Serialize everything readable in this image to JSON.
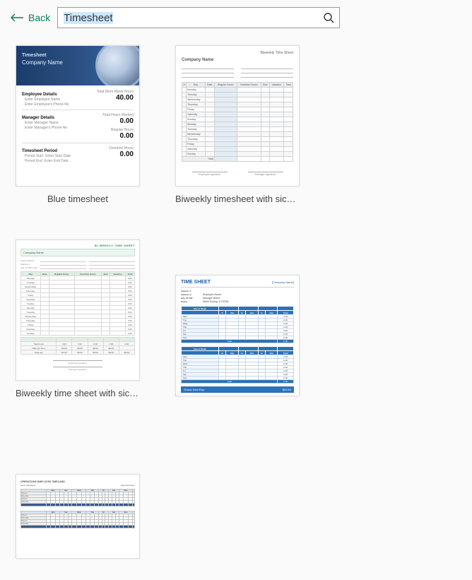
{
  "nav": {
    "back_label": "Back"
  },
  "search": {
    "value": "Timesheet"
  },
  "results": [
    {
      "label": "Blue timesheet"
    },
    {
      "label": "Biweekly timesheet with sick l…"
    },
    {
      "label": "Biweekly time sheet with sick…"
    },
    {
      "label": ""
    },
    {
      "label": ""
    }
  ],
  "thumb1": {
    "title": "Timesheet",
    "company": "Company Name",
    "emp_hdr": "Employee Details",
    "emp_name": "Enter Employee Name",
    "emp_phone": "Enter Employee's Phone No",
    "mgr_hdr": "Manager Details",
    "mgr_name": "Enter Manager Name",
    "mgr_phone": "Enter Manager's Phone No",
    "period_hdr": "Timesheet Period",
    "period_start_lbl": "Period Start",
    "period_start_val": "Enter Start Date",
    "period_end_lbl": "Period End",
    "period_end_val": "Enter End Date",
    "total_week_lbl": "Total Work Week Hours",
    "total_week_val": "40.00",
    "total_worked_lbl": "Total Hours Worked",
    "total_worked_val": "0.00",
    "regular_lbl": "Regular Hours",
    "regular_val": "0.00",
    "overtime_lbl": "Overtime Hours",
    "overtime_val": "0.00"
  },
  "thumb2": {
    "title": "Biweekly Time Sheet",
    "company": "Company Name",
    "cols": [
      "#",
      "Day",
      "Date",
      "Regular Hours",
      "Overtime Hours",
      "Sick",
      "Vacation",
      "Total"
    ],
    "days": [
      "Monday",
      "Tuesday",
      "Wednesday",
      "Thursday",
      "Friday",
      "Saturday",
      "Sunday",
      "Monday",
      "Tuesday",
      "Wednesday",
      "Thursday",
      "Friday",
      "Saturday",
      "Sunday"
    ],
    "total_lbl": "Total",
    "sig_emp": "Employee signature",
    "sig_mgr": "Manager signature"
  },
  "thumb3": {
    "title": "BI-WEEKLY TIME SHEET",
    "company_lbl": "Company Name",
    "addr": "Street Address",
    "addr2": "Address 2",
    "city": "City, ST ZIP Code",
    "mgr": "Manager",
    "emp": "Employee",
    "emp_phone": "Employee phone",
    "emp_email": "Employee email",
    "cols": [
      "Day",
      "Date",
      "Regular Hours",
      "Overtime Hours",
      "Sick",
      "Vacation",
      "Total"
    ],
    "days": [
      "Monday",
      "Tuesday",
      "Wednesday",
      "Thursday",
      "Friday",
      "Saturday",
      "Sunday",
      "Monday",
      "Tuesday",
      "Wednesday",
      "Thursday",
      "Friday",
      "Saturday",
      "Sunday"
    ],
    "row_vals": [
      "0.00",
      "0.00",
      "0.00",
      "0.00",
      "0.00",
      "0.00",
      "0.00",
      "0.00",
      "0.00",
      "0.00",
      "0.00",
      "0.00",
      "0.00",
      "0.00"
    ],
    "total_hours": "Total hours",
    "rate": "Rate per hour",
    "total_pay": "Total pay",
    "sum_vals": [
      "0.00",
      "0.00",
      "0.00",
      "0.00",
      "0.00",
      "$0.00",
      "$0.00",
      "$0.00",
      "$0.00",
      "$0.00",
      "$0.00",
      "$0.00",
      "$0.00",
      "$0.00",
      "$0.00"
    ],
    "sig_emp": "Employee signature",
    "sig_mgr": "Manager signature"
  },
  "thumb4": {
    "heading": "TIME SHEET",
    "company": "[Company Name]",
    "addr1": "Address 1",
    "addr2": "Address 2",
    "city": "City, ST ZIP",
    "phone": "Phone",
    "emp_name_lbl": "Employee Name:",
    "mgr_name_lbl": "Manager Name:",
    "week_ending_lbl": "Week Ending:",
    "week_ending_val": "1/7/2018",
    "day_of_week": "Day of Week",
    "cols": [
      "Day",
      "Morning",
      "Afternoon",
      "Evening",
      "Total"
    ],
    "subcols": [
      "In",
      "Out",
      "In",
      "Out",
      "In",
      "Out"
    ],
    "days": [
      "Mon",
      "Tue",
      "Wed",
      "Thu",
      "Fri",
      "Sat",
      "Sun"
    ],
    "total_lbl": "Total",
    "zero": "0.00",
    "grand_lbl": "Grand Total Pay:",
    "grand_val": "$92.50"
  },
  "thumb5": {
    "title": "OPERATIONS EMPLOYEE TIMECARD",
    "emp_lbl": "Name of Employee:",
    "mgr_lbl": "Supervisor Name:",
    "week_lbl": "Week",
    "daypart": [
      "Mon",
      "Tue",
      "Wed",
      "Thu",
      "Fri",
      "Sat",
      "Sun"
    ],
    "rows": [
      "Time In",
      "Time Out",
      "Time In",
      "Time Out",
      "Total"
    ]
  }
}
